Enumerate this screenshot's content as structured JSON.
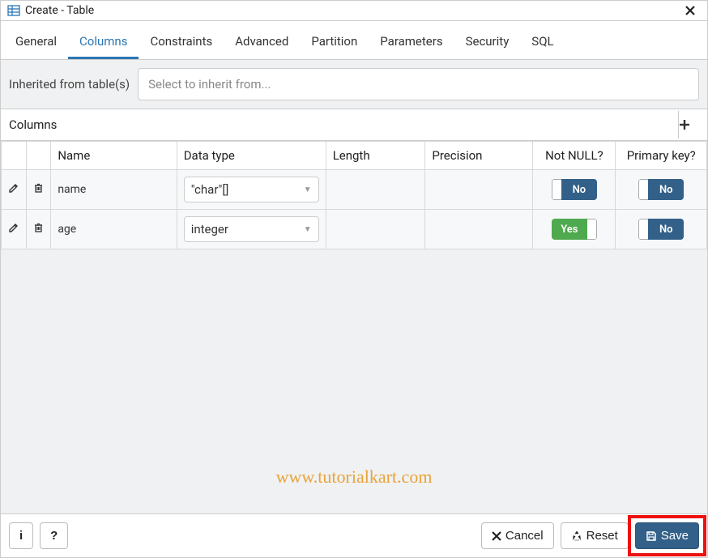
{
  "dialog": {
    "title": "Create - Table"
  },
  "tabs": [
    "General",
    "Columns",
    "Constraints",
    "Advanced",
    "Partition",
    "Parameters",
    "Security",
    "SQL"
  ],
  "active_tab": "Columns",
  "inherit": {
    "label": "Inherited from table(s)",
    "placeholder": "Select to inherit from..."
  },
  "columns_section": {
    "label": "Columns"
  },
  "grid": {
    "headers": {
      "name": "Name",
      "datatype": "Data type",
      "length": "Length",
      "precision": "Precision",
      "notnull": "Not NULL?",
      "pk": "Primary key?"
    },
    "rows": [
      {
        "name": "name",
        "datatype": "\"char\"[]",
        "length": "",
        "precision": "",
        "notnull": false,
        "pk": false
      },
      {
        "name": "age",
        "datatype": "integer",
        "length": "",
        "precision": "",
        "notnull": true,
        "pk": false
      }
    ],
    "toggle_labels": {
      "yes": "Yes",
      "no": "No"
    }
  },
  "footer": {
    "info": "i",
    "help": "?",
    "cancel": "Cancel",
    "reset": "Reset",
    "save": "Save"
  },
  "watermark": "www.tutorialkart.com"
}
